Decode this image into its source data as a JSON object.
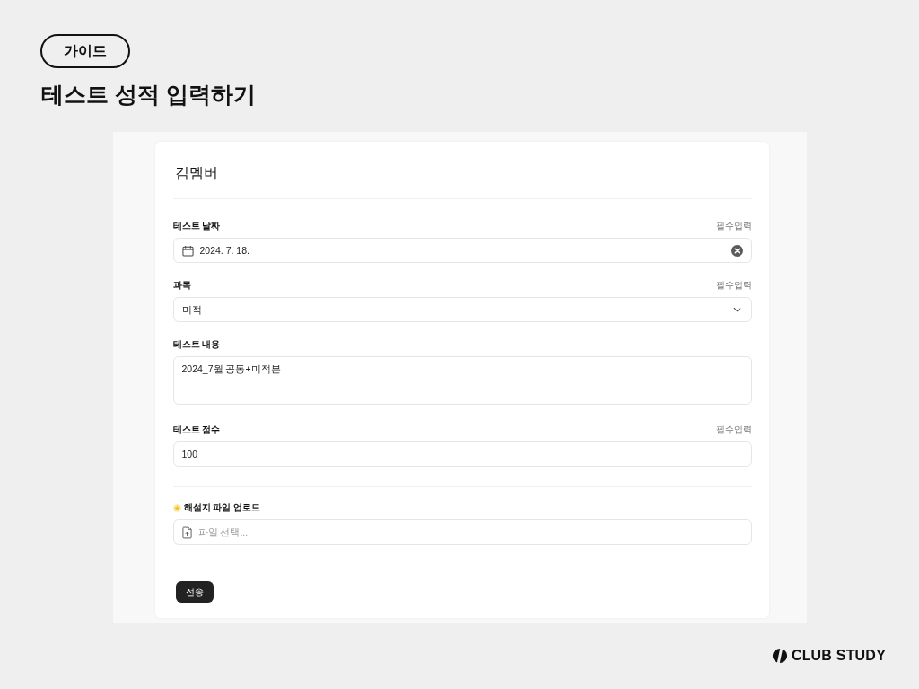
{
  "header": {
    "badge": "가이드",
    "title": "테스트 성적 입력하기"
  },
  "form": {
    "member_name": "김멤버",
    "sections": [
      {
        "fields": [
          {
            "kind": "date",
            "label": "테스트 날짜",
            "required_note": "필수입력",
            "value": "2024. 7. 18."
          },
          {
            "kind": "select",
            "label": "과목",
            "required_note": "필수입력",
            "value": "미적"
          },
          {
            "kind": "textarea",
            "label": "테스트 내용",
            "value": "2024_7월 공동+미적분"
          },
          {
            "kind": "text",
            "label": "테스트 점수",
            "required_note": "필수입력",
            "value": "100"
          }
        ]
      },
      {
        "fields": [
          {
            "kind": "file",
            "label": "해설지 파일 업로드",
            "placeholder": "파일 선택..."
          }
        ]
      }
    ],
    "submit": "전송"
  },
  "brand": "CLUB STUDY"
}
